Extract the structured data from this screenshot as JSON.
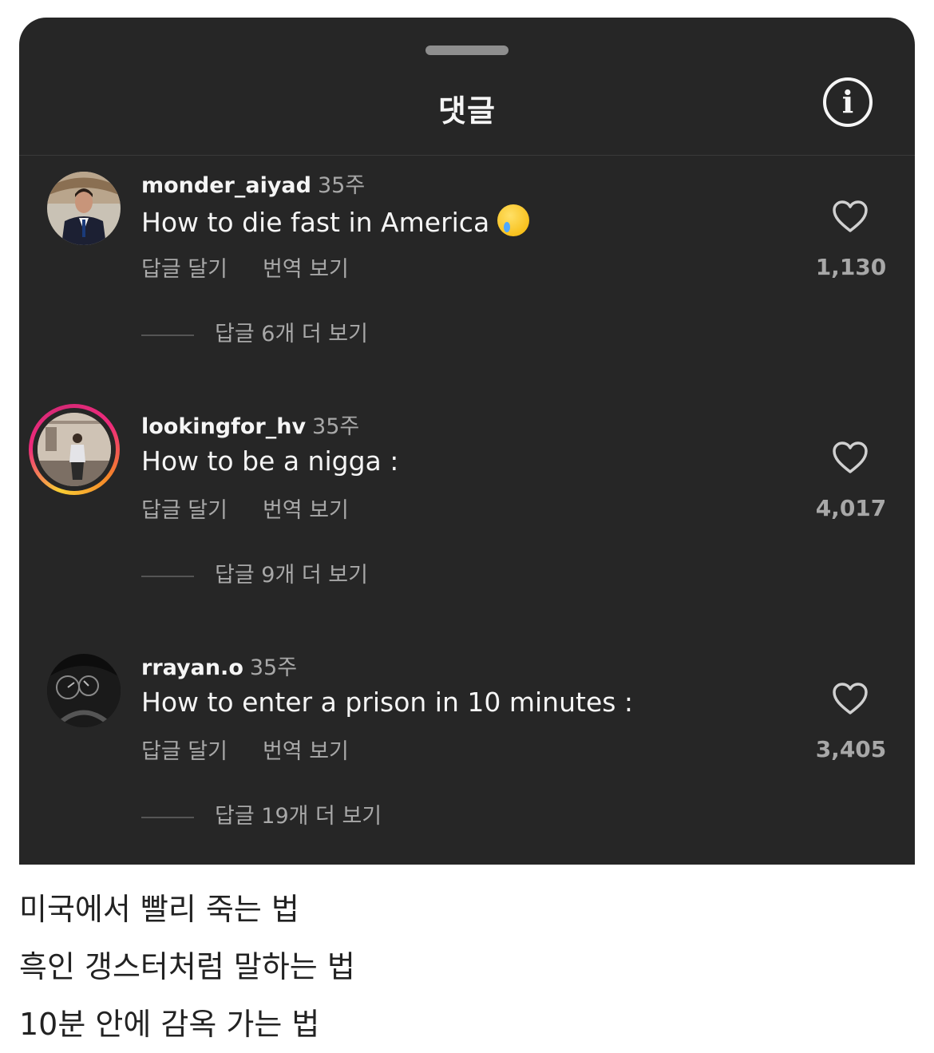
{
  "header": {
    "title": "댓글",
    "info_icon": "i"
  },
  "comments": [
    {
      "username": "monder_aiyad",
      "time": "35주",
      "text": "How to die fast in America",
      "emoji": "face-holding-back-tears",
      "reply_label": "답글 달기",
      "translate_label": "번역 보기",
      "more_replies": "답글 6개 더 보기",
      "likes": "1,130",
      "has_story_ring": false
    },
    {
      "username": "lookingfor_hv",
      "time": "35주",
      "text": "How to be a nigga :",
      "reply_label": "답글 달기",
      "translate_label": "번역 보기",
      "more_replies": "답글 9개 더 보기",
      "likes": "4,017",
      "has_story_ring": true
    },
    {
      "username": "rrayan.o",
      "time": "35주",
      "text": "How to enter a prison in 10 minutes :",
      "reply_label": "답글 달기",
      "translate_label": "번역 보기",
      "more_replies": "답글 19개 더 보기",
      "likes": "3,405",
      "has_story_ring": false
    }
  ],
  "captions": [
    "미국에서 빨리 죽는 법",
    "흑인 갱스터처럼 말하는 법",
    "10분 안에 감옥 가는 법"
  ],
  "colors": {
    "sheet_bg": "#262626",
    "primary_text": "#f5f5f5",
    "secondary_text": "#a8a8a8"
  }
}
